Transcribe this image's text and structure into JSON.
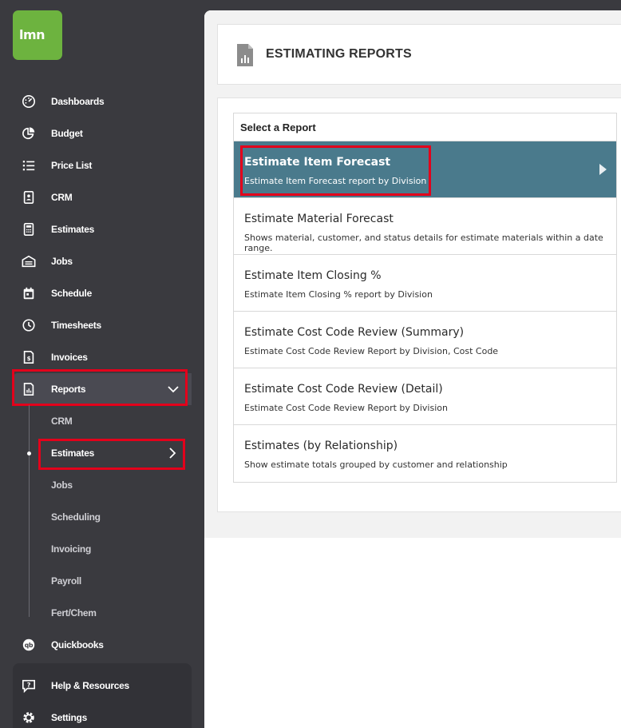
{
  "logo": {
    "text": "lmn"
  },
  "sidebar": {
    "items": [
      {
        "label": "Dashboards",
        "icon": "dashboard-icon"
      },
      {
        "label": "Budget",
        "icon": "pie-chart-icon"
      },
      {
        "label": "Price List",
        "icon": "list-icon"
      },
      {
        "label": "CRM",
        "icon": "contact-card-icon"
      },
      {
        "label": "Estimates",
        "icon": "calculator-icon"
      },
      {
        "label": "Jobs",
        "icon": "garage-icon"
      },
      {
        "label": "Schedule",
        "icon": "calendar-icon"
      },
      {
        "label": "Timesheets",
        "icon": "clock-icon"
      },
      {
        "label": "Invoices",
        "icon": "invoice-icon"
      },
      {
        "label": "Reports",
        "icon": "report-icon"
      }
    ],
    "sub_items": [
      {
        "label": "CRM"
      },
      {
        "label": "Estimates"
      },
      {
        "label": "Jobs"
      },
      {
        "label": "Scheduling"
      },
      {
        "label": "Invoicing"
      },
      {
        "label": "Payroll"
      },
      {
        "label": "Fert/Chem"
      }
    ],
    "quickbooks": {
      "label": "Quickbooks",
      "icon": "quickbooks-icon"
    },
    "help": {
      "label": "Help & Resources",
      "icon": "help-icon"
    },
    "settings": {
      "label": "Settings",
      "icon": "gear-icon"
    }
  },
  "page": {
    "title": "ESTIMATING REPORTS",
    "list_header": "Select a Report",
    "reports": [
      {
        "title": "Estimate Item Forecast",
        "desc": "Estimate Item Forecast report by Division"
      },
      {
        "title": "Estimate Material Forecast",
        "desc": "Shows material, customer, and status details for estimate materials within a date range."
      },
      {
        "title": "Estimate Item Closing %",
        "desc": "Estimate Item Closing % report by Division"
      },
      {
        "title": "Estimate Cost Code Review (Summary)",
        "desc": "Estimate Cost Code Review Report by Division, Cost Code"
      },
      {
        "title": "Estimate Cost Code Review (Detail)",
        "desc": "Estimate Cost Code Review Report by Division"
      },
      {
        "title": "Estimates (by Relationship)",
        "desc": "Show estimate totals grouped by customer and relationship"
      }
    ]
  },
  "colors": {
    "brand": "#6db33f",
    "active_row": "#4a7a8c",
    "sidebar": "#3a3a3f",
    "highlight": "#e3001b"
  }
}
